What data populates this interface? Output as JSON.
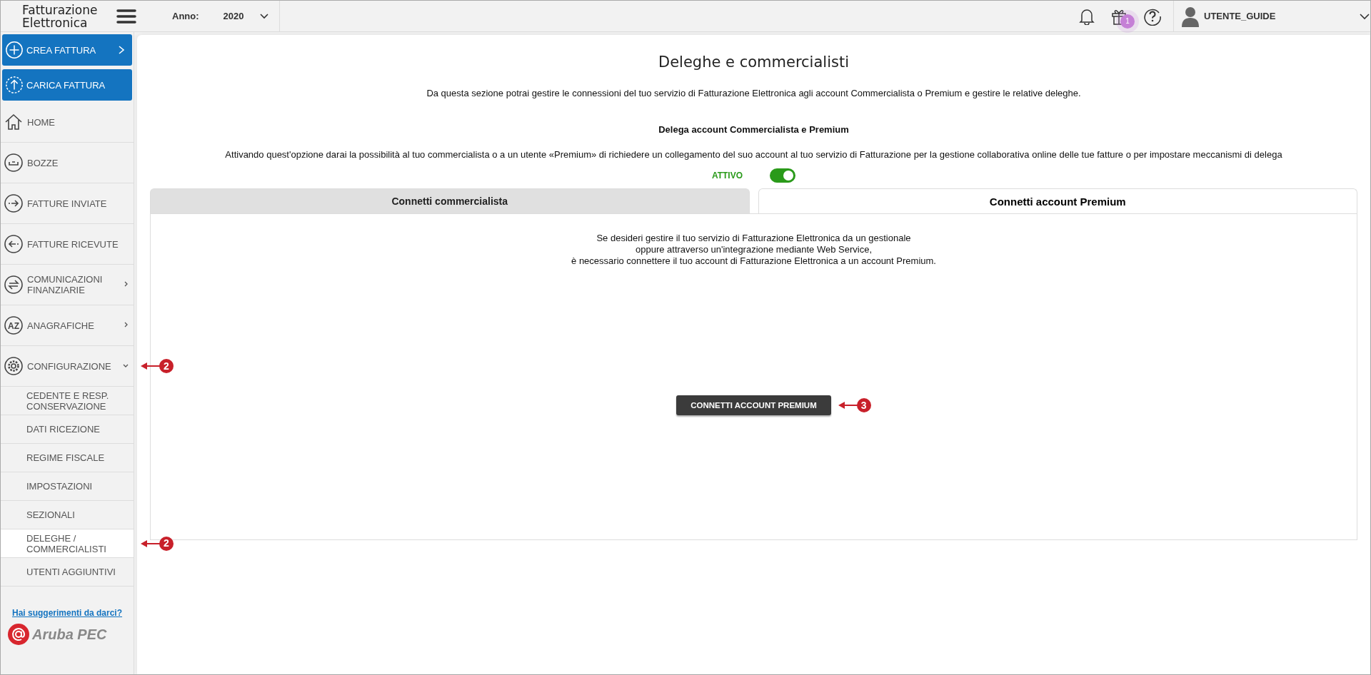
{
  "header": {
    "logo_lines": [
      "Fatturazione",
      "Elettronica"
    ],
    "year_selector": {
      "label": "Anno:",
      "value": "2020"
    },
    "gift_badge": "1",
    "user_name": "UTENTE_GUIDE"
  },
  "sidebar": {
    "actions": [
      {
        "label": "CREA FATTURA",
        "has_arrow": true
      },
      {
        "label": "CARICA FATTURA",
        "has_arrow": false
      }
    ],
    "items": [
      {
        "label": "HOME",
        "kind": "link",
        "selected": false
      },
      {
        "label": "BOZZE",
        "kind": "link",
        "selected": false
      },
      {
        "label": "FATTURE INVIATE",
        "kind": "link",
        "selected": false
      },
      {
        "label": "FATTURE RICEVUTE",
        "kind": "link",
        "selected": false
      },
      {
        "label": "COMUNICAZIONI FINANZIARIE",
        "kind": "group",
        "expanded": false,
        "selected": false
      },
      {
        "label": "ANAGRAFICHE",
        "kind": "group",
        "expanded": false,
        "selected": false,
        "icon_letters": "AZ"
      },
      {
        "label": "CONFIGURAZIONE",
        "kind": "group",
        "expanded": true,
        "selected": false,
        "callout": "2",
        "children": [
          {
            "label": "CEDENTE E RESP. CONSERVAZIONE",
            "selected": false
          },
          {
            "label": "DATI RICEZIONE",
            "selected": false
          },
          {
            "label": "REGIME FISCALE",
            "selected": false
          },
          {
            "label": "IMPOSTAZIONI",
            "selected": false
          },
          {
            "label": "SEZIONALI",
            "selected": false
          },
          {
            "label": "DELEGHE / COMMERCIALISTI",
            "selected": true,
            "callout": "2"
          },
          {
            "label": "UTENTI AGGIUNTIVI",
            "selected": false
          }
        ]
      }
    ],
    "feedback_link": "Hai suggerimenti da darci?",
    "brand": "Aruba PEC"
  },
  "page": {
    "title": "Deleghe e commercialisti",
    "description": "Da questa sezione potrai gestire le connessioni del tuo servizio di Fatturazione Elettronica agli account Commercialista o Premium e gestire le relative deleghe.",
    "section_title": "Delega account Commercialista e Premium",
    "section_text": "Attivando quest'opzione darai la possibilità al tuo commercialista o a un utente «Premium» di richiedere un collegamento del suo account al tuo servizio di Fatturazione per la gestione collaborativa online delle tue fatture o per impostare meccanismi di delega",
    "toggle": {
      "label": "ATTIVO",
      "on": true
    },
    "tabs": [
      {
        "label": "Connetti commercialista",
        "selected": false
      },
      {
        "label": "Connetti account Premium",
        "selected": true
      }
    ],
    "panel_text": [
      "Se desideri gestire il tuo servizio di Fatturazione Elettronica da un gestionale",
      "oppure attraverso un'integrazione mediante Web Service,",
      "è necessario connettere il tuo account di Fatturazione Elettronica a un account Premium."
    ],
    "button": {
      "label": "CONNETTI ACCOUNT PREMIUM",
      "callout": "3"
    }
  }
}
